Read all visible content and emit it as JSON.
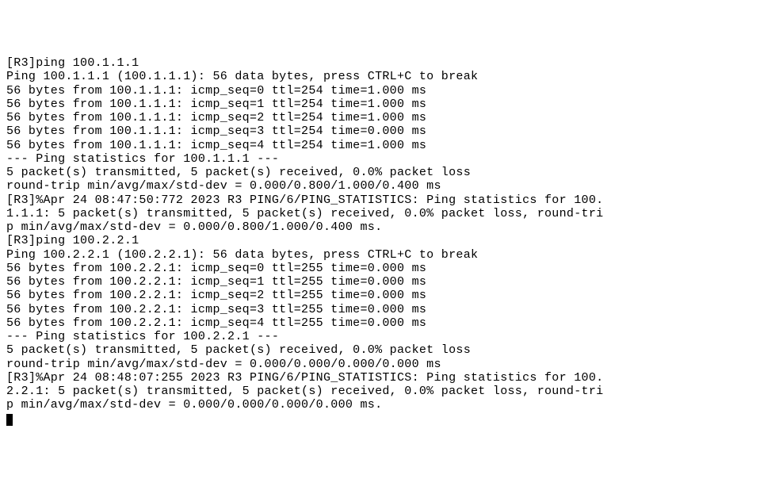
{
  "terminal": {
    "lines": [
      "[R3]ping 100.1.1.1",
      "Ping 100.1.1.1 (100.1.1.1): 56 data bytes, press CTRL+C to break",
      "56 bytes from 100.1.1.1: icmp_seq=0 ttl=254 time=1.000 ms",
      "56 bytes from 100.1.1.1: icmp_seq=1 ttl=254 time=1.000 ms",
      "56 bytes from 100.1.1.1: icmp_seq=2 ttl=254 time=1.000 ms",
      "56 bytes from 100.1.1.1: icmp_seq=3 ttl=254 time=0.000 ms",
      "56 bytes from 100.1.1.1: icmp_seq=4 ttl=254 time=1.000 ms",
      "",
      "--- Ping statistics for 100.1.1.1 ---",
      "5 packet(s) transmitted, 5 packet(s) received, 0.0% packet loss",
      "round-trip min/avg/max/std-dev = 0.000/0.800/1.000/0.400 ms",
      "[R3]%Apr 24 08:47:50:772 2023 R3 PING/6/PING_STATISTICS: Ping statistics for 100.",
      "1.1.1: 5 packet(s) transmitted, 5 packet(s) received, 0.0% packet loss, round-tri",
      "p min/avg/max/std-dev = 0.000/0.800/1.000/0.400 ms.",
      "",
      "[R3]ping 100.2.2.1",
      "Ping 100.2.2.1 (100.2.2.1): 56 data bytes, press CTRL+C to break",
      "56 bytes from 100.2.2.1: icmp_seq=0 ttl=255 time=0.000 ms",
      "56 bytes from 100.2.2.1: icmp_seq=1 ttl=255 time=0.000 ms",
      "56 bytes from 100.2.2.1: icmp_seq=2 ttl=255 time=0.000 ms",
      "56 bytes from 100.2.2.1: icmp_seq=3 ttl=255 time=0.000 ms",
      "56 bytes from 100.2.2.1: icmp_seq=4 ttl=255 time=0.000 ms",
      "",
      "--- Ping statistics for 100.2.2.1 ---",
      "5 packet(s) transmitted, 5 packet(s) received, 0.0% packet loss",
      "round-trip min/avg/max/std-dev = 0.000/0.000/0.000/0.000 ms",
      "[R3]%Apr 24 08:48:07:255 2023 R3 PING/6/PING_STATISTICS: Ping statistics for 100.",
      "2.2.1: 5 packet(s) transmitted, 5 packet(s) received, 0.0% packet loss, round-tri",
      "p min/avg/max/std-dev = 0.000/0.000/0.000/0.000 ms."
    ]
  }
}
